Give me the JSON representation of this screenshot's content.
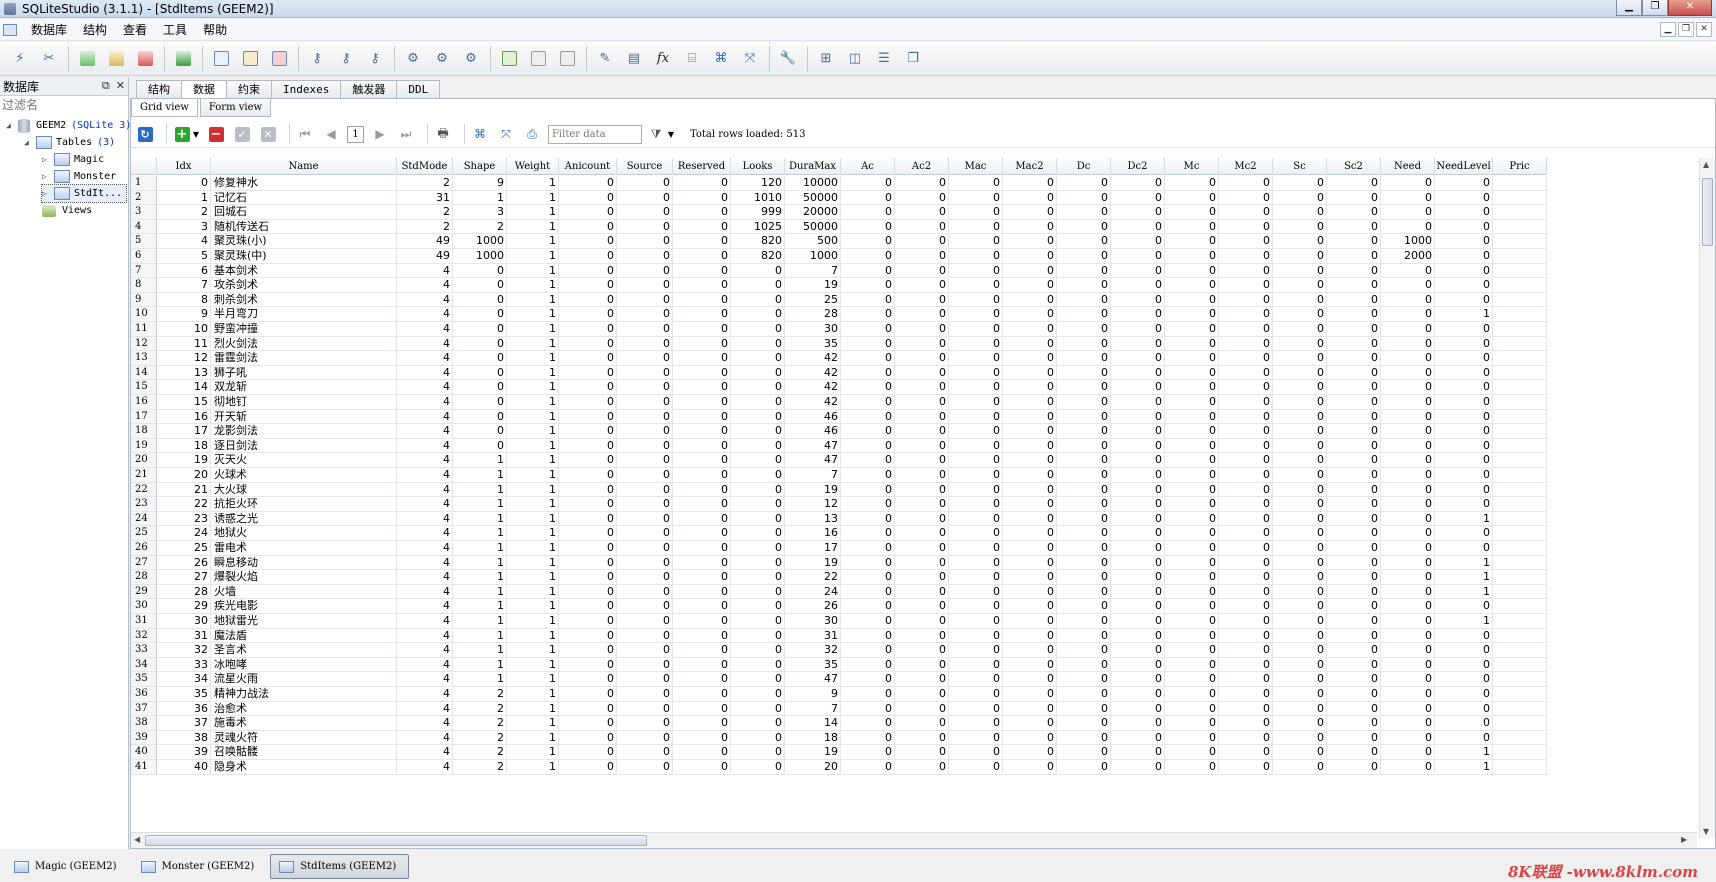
{
  "window": {
    "title": "SQLiteStudio (3.1.1) - [StdItems (GEEM2)]"
  },
  "menu": [
    "数据库",
    "结构",
    "查看",
    "工具",
    "帮助"
  ],
  "dock": {
    "title": "数据库",
    "filter_placeholder": "过滤名",
    "db_name": "GEEM2",
    "db_type": "(SQLite 3)",
    "tables_label": "Tables",
    "tables_count": "(3)",
    "tables": [
      "Magic",
      "Monster",
      "StdIt..."
    ],
    "views_label": "Views"
  },
  "tabs": [
    "结构",
    "数据",
    "约束",
    "Indexes",
    "触发器",
    "DDL"
  ],
  "subtabs": [
    "Grid view",
    "Form view"
  ],
  "gridbar": {
    "page": "1",
    "filter_placeholder": "Filter data",
    "rows_loaded": "Total rows loaded: 513"
  },
  "grid": {
    "columns": [
      "Idx",
      "Name",
      "StdMode",
      "Shape",
      "Weight",
      "Anicount",
      "Source",
      "Reserved",
      "Looks",
      "DuraMax",
      "Ac",
      "Ac2",
      "Mac",
      "Mac2",
      "Dc",
      "Dc2",
      "Mc",
      "Mc2",
      "Sc",
      "Sc2",
      "Need",
      "NeedLevel",
      "Pric"
    ],
    "rows": [
      [
        "0",
        "修复神水",
        "2",
        "9",
        "1",
        "0",
        "0",
        "0",
        "120",
        "10000",
        "0",
        "0",
        "0",
        "0",
        "0",
        "0",
        "0",
        "0",
        "0",
        "0",
        "0",
        "0"
      ],
      [
        "1",
        "记忆石",
        "31",
        "1",
        "1",
        "0",
        "0",
        "0",
        "1010",
        "50000",
        "0",
        "0",
        "0",
        "0",
        "0",
        "0",
        "0",
        "0",
        "0",
        "0",
        "0",
        "0"
      ],
      [
        "2",
        "回城石",
        "2",
        "3",
        "1",
        "0",
        "0",
        "0",
        "999",
        "20000",
        "0",
        "0",
        "0",
        "0",
        "0",
        "0",
        "0",
        "0",
        "0",
        "0",
        "0",
        "0"
      ],
      [
        "3",
        "随机传送石",
        "2",
        "2",
        "1",
        "0",
        "0",
        "0",
        "1025",
        "50000",
        "0",
        "0",
        "0",
        "0",
        "0",
        "0",
        "0",
        "0",
        "0",
        "0",
        "0",
        "0"
      ],
      [
        "4",
        "聚灵珠(小)",
        "49",
        "1000",
        "1",
        "0",
        "0",
        "0",
        "820",
        "500",
        "0",
        "0",
        "0",
        "0",
        "0",
        "0",
        "0",
        "0",
        "0",
        "0",
        "1000",
        "0"
      ],
      [
        "5",
        "聚灵珠(中)",
        "49",
        "1000",
        "1",
        "0",
        "0",
        "0",
        "820",
        "1000",
        "0",
        "0",
        "0",
        "0",
        "0",
        "0",
        "0",
        "0",
        "0",
        "0",
        "2000",
        "0"
      ],
      [
        "6",
        "基本剑术",
        "4",
        "0",
        "1",
        "0",
        "0",
        "0",
        "0",
        "7",
        "0",
        "0",
        "0",
        "0",
        "0",
        "0",
        "0",
        "0",
        "0",
        "0",
        "0",
        "0"
      ],
      [
        "7",
        "攻杀剑术",
        "4",
        "0",
        "1",
        "0",
        "0",
        "0",
        "0",
        "19",
        "0",
        "0",
        "0",
        "0",
        "0",
        "0",
        "0",
        "0",
        "0",
        "0",
        "0",
        "0"
      ],
      [
        "8",
        "刺杀剑术",
        "4",
        "0",
        "1",
        "0",
        "0",
        "0",
        "0",
        "25",
        "0",
        "0",
        "0",
        "0",
        "0",
        "0",
        "0",
        "0",
        "0",
        "0",
        "0",
        "0"
      ],
      [
        "9",
        "半月弯刀",
        "4",
        "0",
        "1",
        "0",
        "0",
        "0",
        "0",
        "28",
        "0",
        "0",
        "0",
        "0",
        "0",
        "0",
        "0",
        "0",
        "0",
        "0",
        "0",
        "1"
      ],
      [
        "10",
        "野蛮冲撞",
        "4",
        "0",
        "1",
        "0",
        "0",
        "0",
        "0",
        "30",
        "0",
        "0",
        "0",
        "0",
        "0",
        "0",
        "0",
        "0",
        "0",
        "0",
        "0",
        "0"
      ],
      [
        "11",
        "烈火剑法",
        "4",
        "0",
        "1",
        "0",
        "0",
        "0",
        "0",
        "35",
        "0",
        "0",
        "0",
        "0",
        "0",
        "0",
        "0",
        "0",
        "0",
        "0",
        "0",
        "0"
      ],
      [
        "12",
        "雷霆剑法",
        "4",
        "0",
        "1",
        "0",
        "0",
        "0",
        "0",
        "42",
        "0",
        "0",
        "0",
        "0",
        "0",
        "0",
        "0",
        "0",
        "0",
        "0",
        "0",
        "0"
      ],
      [
        "13",
        "狮子吼",
        "4",
        "0",
        "1",
        "0",
        "0",
        "0",
        "0",
        "42",
        "0",
        "0",
        "0",
        "0",
        "0",
        "0",
        "0",
        "0",
        "0",
        "0",
        "0",
        "0"
      ],
      [
        "14",
        "双龙斩",
        "4",
        "0",
        "1",
        "0",
        "0",
        "0",
        "0",
        "42",
        "0",
        "0",
        "0",
        "0",
        "0",
        "0",
        "0",
        "0",
        "0",
        "0",
        "0",
        "0"
      ],
      [
        "15",
        "彻地钉",
        "4",
        "0",
        "1",
        "0",
        "0",
        "0",
        "0",
        "42",
        "0",
        "0",
        "0",
        "0",
        "0",
        "0",
        "0",
        "0",
        "0",
        "0",
        "0",
        "0"
      ],
      [
        "16",
        "开天斩",
        "4",
        "0",
        "1",
        "0",
        "0",
        "0",
        "0",
        "46",
        "0",
        "0",
        "0",
        "0",
        "0",
        "0",
        "0",
        "0",
        "0",
        "0",
        "0",
        "0"
      ],
      [
        "17",
        "龙影剑法",
        "4",
        "0",
        "1",
        "0",
        "0",
        "0",
        "0",
        "46",
        "0",
        "0",
        "0",
        "0",
        "0",
        "0",
        "0",
        "0",
        "0",
        "0",
        "0",
        "0"
      ],
      [
        "18",
        "逐日剑法",
        "4",
        "0",
        "1",
        "0",
        "0",
        "0",
        "0",
        "47",
        "0",
        "0",
        "0",
        "0",
        "0",
        "0",
        "0",
        "0",
        "0",
        "0",
        "0",
        "0"
      ],
      [
        "19",
        "灭天火",
        "4",
        "1",
        "1",
        "0",
        "0",
        "0",
        "0",
        "47",
        "0",
        "0",
        "0",
        "0",
        "0",
        "0",
        "0",
        "0",
        "0",
        "0",
        "0",
        "0"
      ],
      [
        "20",
        "火球术",
        "4",
        "1",
        "1",
        "0",
        "0",
        "0",
        "0",
        "7",
        "0",
        "0",
        "0",
        "0",
        "0",
        "0",
        "0",
        "0",
        "0",
        "0",
        "0",
        "0"
      ],
      [
        "21",
        "大火球",
        "4",
        "1",
        "1",
        "0",
        "0",
        "0",
        "0",
        "19",
        "0",
        "0",
        "0",
        "0",
        "0",
        "0",
        "0",
        "0",
        "0",
        "0",
        "0",
        "0"
      ],
      [
        "22",
        "抗拒火环",
        "4",
        "1",
        "1",
        "0",
        "0",
        "0",
        "0",
        "12",
        "0",
        "0",
        "0",
        "0",
        "0",
        "0",
        "0",
        "0",
        "0",
        "0",
        "0",
        "0"
      ],
      [
        "23",
        "诱惑之光",
        "4",
        "1",
        "1",
        "0",
        "0",
        "0",
        "0",
        "13",
        "0",
        "0",
        "0",
        "0",
        "0",
        "0",
        "0",
        "0",
        "0",
        "0",
        "0",
        "1"
      ],
      [
        "24",
        "地狱火",
        "4",
        "1",
        "1",
        "0",
        "0",
        "0",
        "0",
        "16",
        "0",
        "0",
        "0",
        "0",
        "0",
        "0",
        "0",
        "0",
        "0",
        "0",
        "0",
        "0"
      ],
      [
        "25",
        "雷电术",
        "4",
        "1",
        "1",
        "0",
        "0",
        "0",
        "0",
        "17",
        "0",
        "0",
        "0",
        "0",
        "0",
        "0",
        "0",
        "0",
        "0",
        "0",
        "0",
        "0"
      ],
      [
        "26",
        "瞬息移动",
        "4",
        "1",
        "1",
        "0",
        "0",
        "0",
        "0",
        "19",
        "0",
        "0",
        "0",
        "0",
        "0",
        "0",
        "0",
        "0",
        "0",
        "0",
        "0",
        "1"
      ],
      [
        "27",
        "爆裂火焰",
        "4",
        "1",
        "1",
        "0",
        "0",
        "0",
        "0",
        "22",
        "0",
        "0",
        "0",
        "0",
        "0",
        "0",
        "0",
        "0",
        "0",
        "0",
        "0",
        "1"
      ],
      [
        "28",
        "火墙",
        "4",
        "1",
        "1",
        "0",
        "0",
        "0",
        "0",
        "24",
        "0",
        "0",
        "0",
        "0",
        "0",
        "0",
        "0",
        "0",
        "0",
        "0",
        "0",
        "1"
      ],
      [
        "29",
        "疾光电影",
        "4",
        "1",
        "1",
        "0",
        "0",
        "0",
        "0",
        "26",
        "0",
        "0",
        "0",
        "0",
        "0",
        "0",
        "0",
        "0",
        "0",
        "0",
        "0",
        "0"
      ],
      [
        "30",
        "地狱雷光",
        "4",
        "1",
        "1",
        "0",
        "0",
        "0",
        "0",
        "30",
        "0",
        "0",
        "0",
        "0",
        "0",
        "0",
        "0",
        "0",
        "0",
        "0",
        "0",
        "1"
      ],
      [
        "31",
        "魔法盾",
        "4",
        "1",
        "1",
        "0",
        "0",
        "0",
        "0",
        "31",
        "0",
        "0",
        "0",
        "0",
        "0",
        "0",
        "0",
        "0",
        "0",
        "0",
        "0",
        "0"
      ],
      [
        "32",
        "圣言术",
        "4",
        "1",
        "1",
        "0",
        "0",
        "0",
        "0",
        "32",
        "0",
        "0",
        "0",
        "0",
        "0",
        "0",
        "0",
        "0",
        "0",
        "0",
        "0",
        "0"
      ],
      [
        "33",
        "冰咆哮",
        "4",
        "1",
        "1",
        "0",
        "0",
        "0",
        "0",
        "35",
        "0",
        "0",
        "0",
        "0",
        "0",
        "0",
        "0",
        "0",
        "0",
        "0",
        "0",
        "0"
      ],
      [
        "34",
        "流星火雨",
        "4",
        "1",
        "1",
        "0",
        "0",
        "0",
        "0",
        "47",
        "0",
        "0",
        "0",
        "0",
        "0",
        "0",
        "0",
        "0",
        "0",
        "0",
        "0",
        "0"
      ],
      [
        "35",
        "精神力战法",
        "4",
        "2",
        "1",
        "0",
        "0",
        "0",
        "0",
        "9",
        "0",
        "0",
        "0",
        "0",
        "0",
        "0",
        "0",
        "0",
        "0",
        "0",
        "0",
        "0"
      ],
      [
        "36",
        "治愈术",
        "4",
        "2",
        "1",
        "0",
        "0",
        "0",
        "0",
        "7",
        "0",
        "0",
        "0",
        "0",
        "0",
        "0",
        "0",
        "0",
        "0",
        "0",
        "0",
        "0"
      ],
      [
        "37",
        "施毒术",
        "4",
        "2",
        "1",
        "0",
        "0",
        "0",
        "0",
        "14",
        "0",
        "0",
        "0",
        "0",
        "0",
        "0",
        "0",
        "0",
        "0",
        "0",
        "0",
        "0"
      ],
      [
        "38",
        "灵魂火符",
        "4",
        "2",
        "1",
        "0",
        "0",
        "0",
        "0",
        "18",
        "0",
        "0",
        "0",
        "0",
        "0",
        "0",
        "0",
        "0",
        "0",
        "0",
        "0",
        "0"
      ],
      [
        "39",
        "召唤骷髅",
        "4",
        "2",
        "1",
        "0",
        "0",
        "0",
        "0",
        "19",
        "0",
        "0",
        "0",
        "0",
        "0",
        "0",
        "0",
        "0",
        "0",
        "0",
        "0",
        "1"
      ],
      [
        "40",
        "隐身术",
        "4",
        "2",
        "1",
        "0",
        "0",
        "0",
        "0",
        "20",
        "0",
        "0",
        "0",
        "0",
        "0",
        "0",
        "0",
        "0",
        "0",
        "0",
        "0",
        "1"
      ]
    ]
  },
  "window_tabs": [
    "Magic (GEEM2)",
    "Monster (GEEM2)",
    "StdItems (GEEM2)"
  ],
  "watermark": "8K联盟 -www.8klm.com",
  "colors": {
    "accent": "#2a6cc4",
    "add": "#2fa52f",
    "delete": "#d03030"
  }
}
